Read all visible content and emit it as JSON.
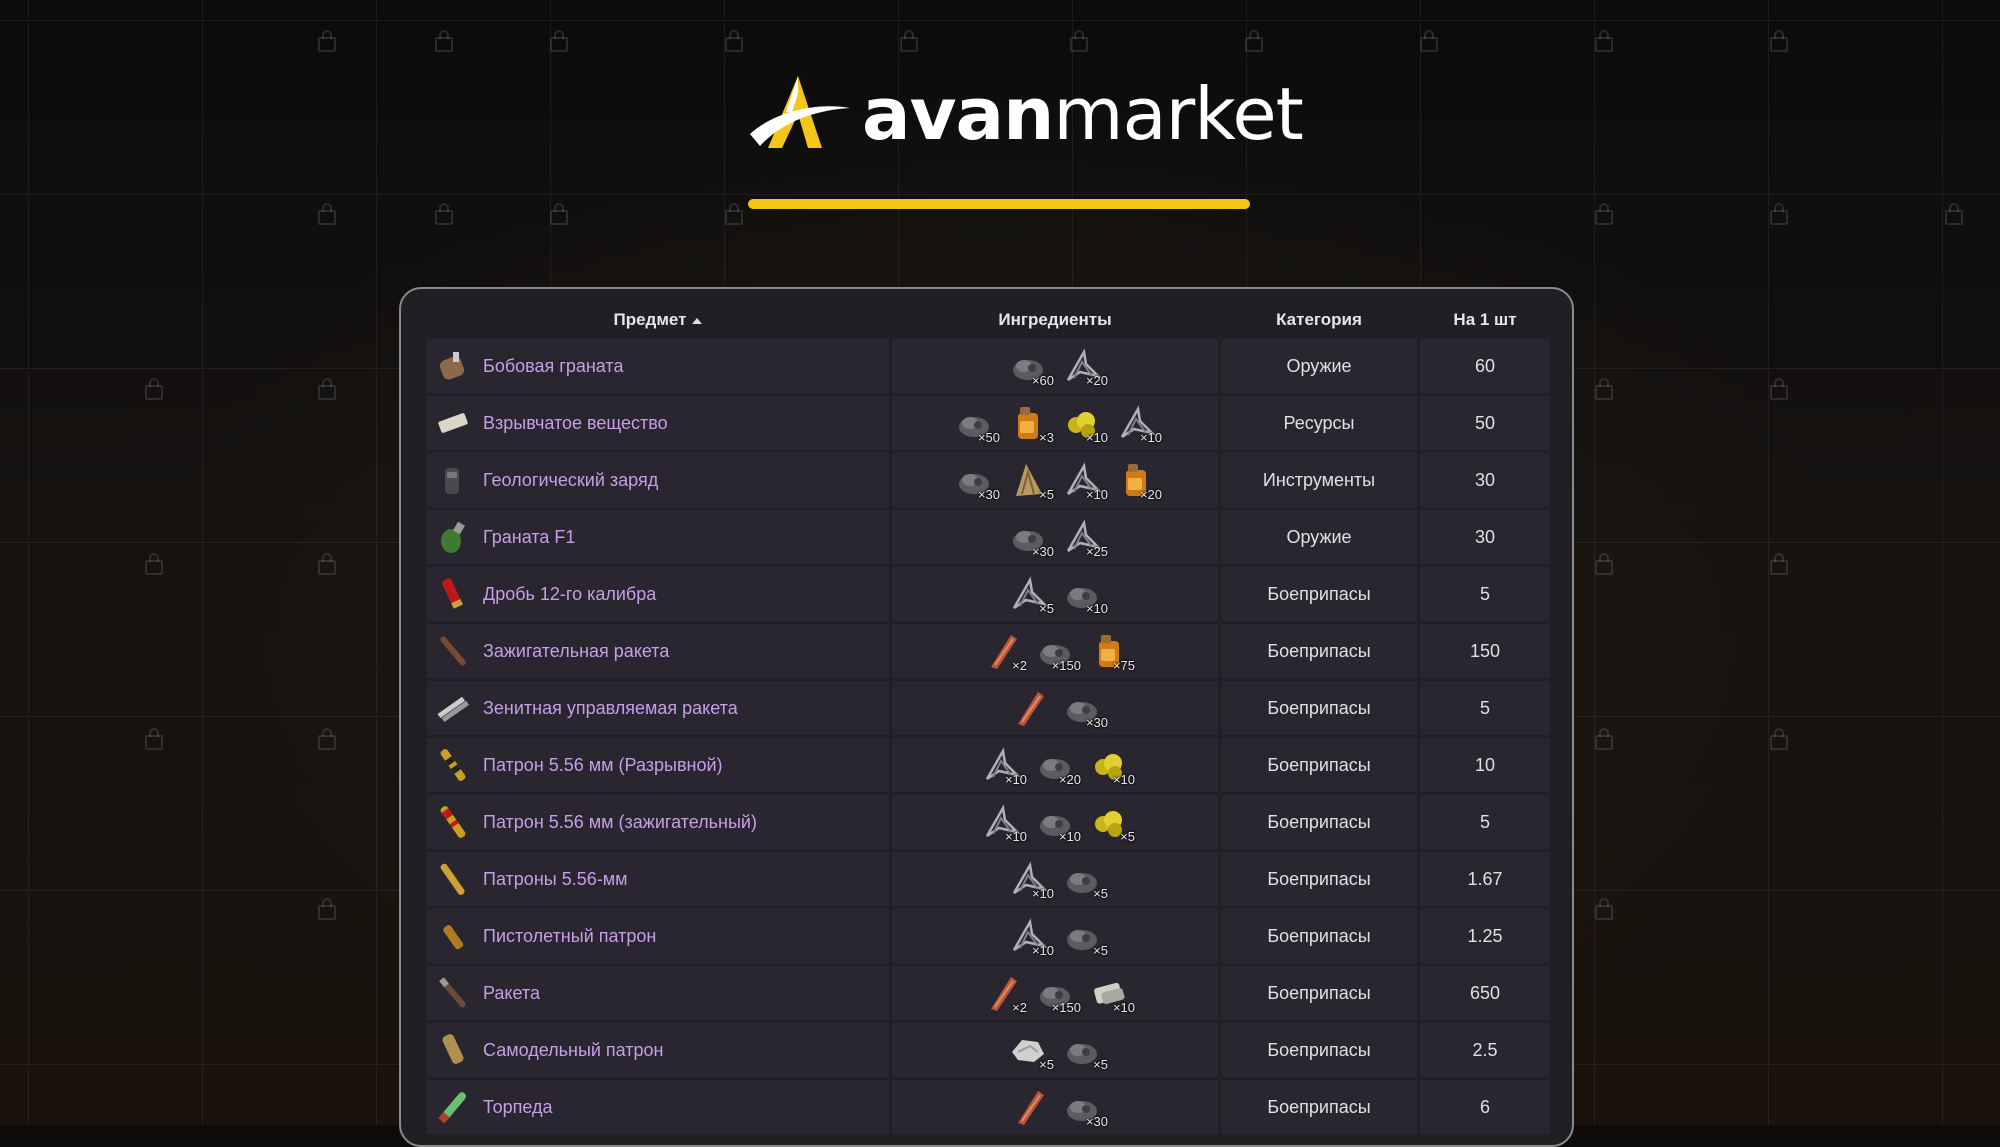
{
  "brand": {
    "name_bold": "avan",
    "name_light": "market",
    "accent": "#f5c518"
  },
  "table": {
    "headers": {
      "item": "Предмет",
      "ingredients": "Ингредиенты",
      "category": "Категория",
      "per_unit": "На 1 шт"
    },
    "sort_icon": "sort-asc-icon",
    "rows": [
      {
        "name": "Бобовая граната",
        "icon": "beancan-grenade-icon",
        "category": "Оружие",
        "per_unit": "60",
        "ingredients": [
          {
            "icon": "gunpowder-icon",
            "qty": "×60"
          },
          {
            "icon": "metal-fragments-icon",
            "qty": "×20"
          }
        ]
      },
      {
        "name": "Взрывчатое вещество",
        "icon": "explosives-icon",
        "category": "Ресурсы",
        "per_unit": "50",
        "ingredients": [
          {
            "icon": "gunpowder-icon",
            "qty": "×50"
          },
          {
            "icon": "low-grade-fuel-icon",
            "qty": "×3"
          },
          {
            "icon": "sulfur-icon",
            "qty": "×10"
          },
          {
            "icon": "metal-fragments-icon",
            "qty": "×10"
          }
        ]
      },
      {
        "name": "Геологический заряд",
        "icon": "geological-charge-icon",
        "category": "Инструменты",
        "per_unit": "30",
        "ingredients": [
          {
            "icon": "gunpowder-icon",
            "qty": "×30"
          },
          {
            "icon": "cloth-icon",
            "qty": "×5"
          },
          {
            "icon": "metal-fragments-icon",
            "qty": "×10"
          },
          {
            "icon": "low-grade-fuel-icon",
            "qty": "×20"
          }
        ]
      },
      {
        "name": "Граната F1",
        "icon": "f1-grenade-icon",
        "category": "Оружие",
        "per_unit": "30",
        "ingredients": [
          {
            "icon": "gunpowder-icon",
            "qty": "×30"
          },
          {
            "icon": "metal-fragments-icon",
            "qty": "×25"
          }
        ]
      },
      {
        "name": "Дробь 12-го калибра",
        "icon": "buckshot-icon",
        "category": "Боеприпасы",
        "per_unit": "5",
        "ingredients": [
          {
            "icon": "metal-fragments-icon",
            "qty": "×5"
          },
          {
            "icon": "gunpowder-icon",
            "qty": "×10"
          }
        ]
      },
      {
        "name": "Зажигательная ракета",
        "icon": "incendiary-rocket-icon",
        "category": "Боеприпасы",
        "per_unit": "150",
        "ingredients": [
          {
            "icon": "metal-pipe-icon",
            "qty": "×2"
          },
          {
            "icon": "gunpowder-icon",
            "qty": "×150"
          },
          {
            "icon": "low-grade-fuel-icon",
            "qty": "×75"
          }
        ]
      },
      {
        "name": "Зенитная управляемая ракета",
        "icon": "sam-ammo-icon",
        "category": "Боеприпасы",
        "per_unit": "5",
        "ingredients": [
          {
            "icon": "metal-pipe-icon",
            "qty": ""
          },
          {
            "icon": "gunpowder-icon",
            "qty": "×30"
          }
        ]
      },
      {
        "name": "Патрон 5.56 мм (Разрывной)",
        "icon": "explosive-ammo-icon",
        "category": "Боеприпасы",
        "per_unit": "10",
        "ingredients": [
          {
            "icon": "metal-fragments-icon",
            "qty": "×10"
          },
          {
            "icon": "gunpowder-icon",
            "qty": "×20"
          },
          {
            "icon": "sulfur-icon",
            "qty": "×10"
          }
        ]
      },
      {
        "name": "Патрон 5.56 мм (зажигательный)",
        "icon": "incendiary-ammo-icon",
        "category": "Боеприпасы",
        "per_unit": "5",
        "ingredients": [
          {
            "icon": "metal-fragments-icon",
            "qty": "×10"
          },
          {
            "icon": "gunpowder-icon",
            "qty": "×10"
          },
          {
            "icon": "sulfur-icon",
            "qty": "×5"
          }
        ]
      },
      {
        "name": "Патроны 5.56-мм",
        "icon": "rifle-ammo-icon",
        "category": "Боеприпасы",
        "per_unit": "1.67",
        "ingredients": [
          {
            "icon": "metal-fragments-icon",
            "qty": "×10"
          },
          {
            "icon": "gunpowder-icon",
            "qty": "×5"
          }
        ]
      },
      {
        "name": "Пистолетный патрон",
        "icon": "pistol-ammo-icon",
        "category": "Боеприпасы",
        "per_unit": "1.25",
        "ingredients": [
          {
            "icon": "metal-fragments-icon",
            "qty": "×10"
          },
          {
            "icon": "gunpowder-icon",
            "qty": "×5"
          }
        ]
      },
      {
        "name": "Ракета",
        "icon": "rocket-icon",
        "category": "Боеприпасы",
        "per_unit": "650",
        "ingredients": [
          {
            "icon": "metal-pipe-icon",
            "qty": "×2"
          },
          {
            "icon": "gunpowder-icon",
            "qty": "×150"
          },
          {
            "icon": "explosives-icon",
            "qty": "×10"
          }
        ]
      },
      {
        "name": "Самодельный патрон",
        "icon": "handmade-shell-icon",
        "category": "Боеприпасы",
        "per_unit": "2.5",
        "ingredients": [
          {
            "icon": "stones-icon",
            "qty": "×5"
          },
          {
            "icon": "gunpowder-icon",
            "qty": "×5"
          }
        ]
      },
      {
        "name": "Торпеда",
        "icon": "torpedo-icon",
        "category": "Боеприпасы",
        "per_unit": "6",
        "ingredients": [
          {
            "icon": "metal-pipe-icon",
            "qty": ""
          },
          {
            "icon": "gunpowder-icon",
            "qty": "×30"
          }
        ]
      }
    ]
  }
}
